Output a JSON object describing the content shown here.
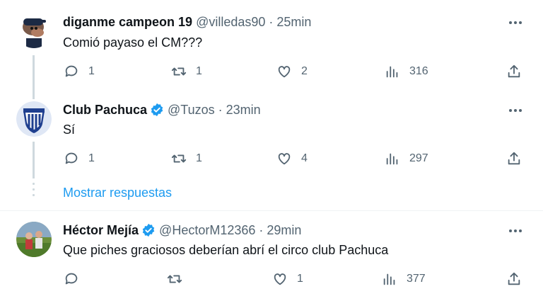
{
  "tweets": [
    {
      "name": "diganme campeon 19",
      "handle": "@villedas90",
      "separator": "·",
      "time": "25min",
      "text": "Comió payaso el CM???",
      "replies": "1",
      "retweets": "1",
      "likes": "2",
      "views": "316",
      "verified": false
    },
    {
      "name": "Club Pachuca",
      "handle": "@Tuzos",
      "separator": "·",
      "time": "23min",
      "text": "Sí",
      "replies": "1",
      "retweets": "1",
      "likes": "4",
      "views": "297",
      "verified": true
    },
    {
      "name": "Héctor Mejía",
      "handle": "@HectorM12366",
      "separator": "·",
      "time": "29min",
      "text": "Que piches graciosos deberían abrí el circo club Pachuca",
      "replies": "",
      "retweets": "",
      "likes": "1",
      "views": "377",
      "verified": true
    }
  ],
  "show_replies_label": "Mostrar respuestas",
  "colors": {
    "accent": "#1d9bf0",
    "muted": "#536471",
    "text": "#0f1419",
    "thread_line": "#cfd9de",
    "verified": "#1d9bf0"
  },
  "icons": {
    "reply": "reply-icon",
    "retweet": "retweet-icon",
    "like": "heart-icon",
    "views": "views-icon",
    "share": "share-icon",
    "more": "more-icon",
    "verified": "verified-badge-icon"
  }
}
